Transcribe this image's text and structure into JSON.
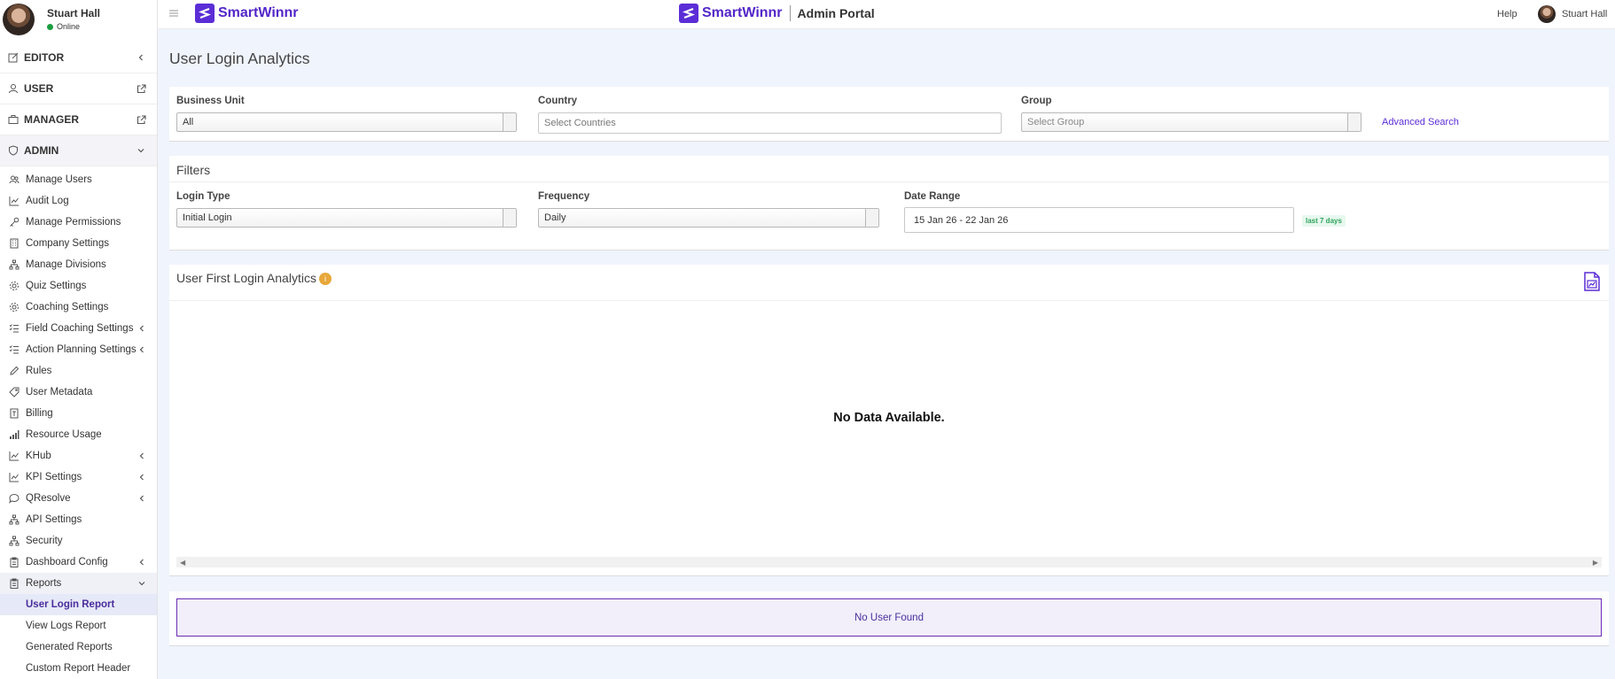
{
  "sidebar": {
    "user_name": "Stuart Hall",
    "user_status": "Online",
    "sections": {
      "editor": "EDITOR",
      "user": "USER",
      "manager": "MANAGER",
      "admin": "ADMIN"
    },
    "admin_items": [
      "Manage Users",
      "Audit Log",
      "Manage Permissions",
      "Company Settings",
      "Manage Divisions",
      "Quiz Settings",
      "Coaching Settings",
      "Field Coaching Settings",
      "Action Planning Settings",
      "Rules",
      "User Metadata",
      "Billing",
      "Resource Usage",
      "KHub",
      "KPI Settings",
      "QResolve",
      "API Settings",
      "Security",
      "Dashboard Config",
      "Reports"
    ],
    "report_items": [
      "User Login Report",
      "View Logs Report",
      "Generated Reports",
      "Custom Report Header"
    ]
  },
  "header": {
    "brand": "SmartWinnr",
    "portal_brand": "SmartWinnr",
    "portal_label": "Admin Portal",
    "help": "Help",
    "user_name": "Stuart Hall"
  },
  "page": {
    "title": "User Login Analytics"
  },
  "search": {
    "business_unit_label": "Business Unit",
    "business_unit_value": "All",
    "country_label": "Country",
    "country_placeholder": "Select Countries",
    "group_label": "Group",
    "group_placeholder": "Select Group",
    "advanced_search": "Advanced Search"
  },
  "filters": {
    "title": "Filters",
    "login_type_label": "Login Type",
    "login_type_value": "Initial Login",
    "frequency_label": "Frequency",
    "frequency_value": "Daily",
    "date_range_label": "Date Range",
    "date_range_value": "15 Jan 26 - 22 Jan 26",
    "date_badge": "last 7 days"
  },
  "analytics": {
    "title": "User First Login Analytics",
    "info": "i",
    "no_data": "No Data Available."
  },
  "users": {
    "no_user": "No User Found"
  },
  "colors": {
    "brand": "#5b2dd6",
    "active_bg": "#e6e9f7",
    "online": "#1a9e3f",
    "badge_text": "#2fa35d",
    "info": "#e8a73a"
  }
}
